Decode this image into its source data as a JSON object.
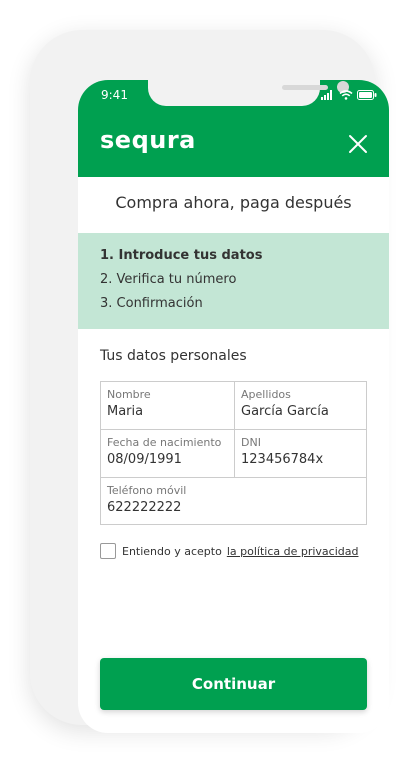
{
  "status_bar": {
    "time": "9:41"
  },
  "header": {
    "logo_text": "sequra",
    "brand_color": "#00a050"
  },
  "title": "Compra ahora, paga después",
  "steps": [
    {
      "label": "1. Introduce tus datos",
      "active": true
    },
    {
      "label": "2. Verifica tu número",
      "active": false
    },
    {
      "label": "3. Confirmación",
      "active": false
    }
  ],
  "steps_background": "#c3e6d5",
  "form": {
    "section_label": "Tus datos personales",
    "fields": {
      "nombre": {
        "label": "Nombre",
        "value": "Maria"
      },
      "apellidos": {
        "label": "Apellidos",
        "value": "García García"
      },
      "fecha": {
        "label": "Fecha de nacimiento",
        "value": "08/09/1991"
      },
      "dni": {
        "label": "DNI",
        "value": "123456784x"
      },
      "telefono": {
        "label": "Teléfono móvil",
        "value": "622222222"
      }
    }
  },
  "consent": {
    "text": "Entiendo y acepto",
    "link": "la política de privacidad",
    "checked": false
  },
  "cta": {
    "label": "Continuar"
  },
  "icons": {
    "close": "close-icon",
    "signal": "signal-icon",
    "wifi": "wifi-icon",
    "battery": "battery-icon"
  }
}
